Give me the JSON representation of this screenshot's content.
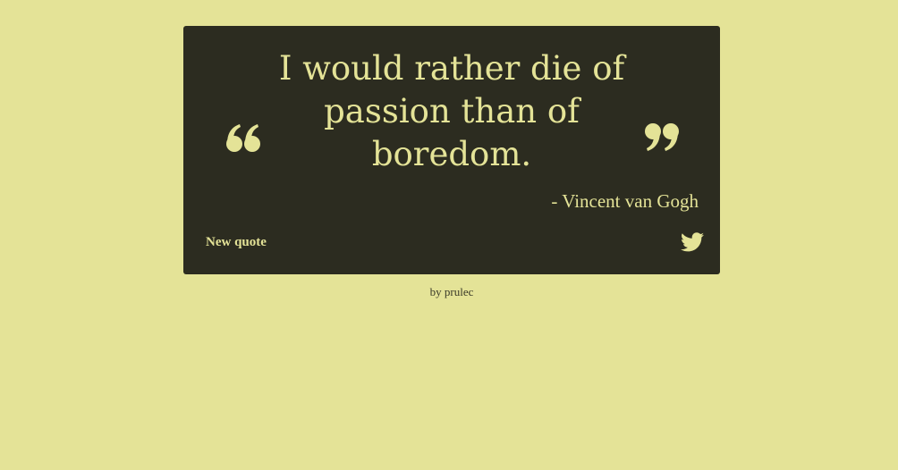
{
  "quote": {
    "text": "I would rather die of passion than of boredom.",
    "author": "- Vincent van Gogh"
  },
  "actions": {
    "new_quote_label": "New quote",
    "tweet_icon": "twitter-icon"
  },
  "footer": {
    "prefix": "by",
    "author_link": "prulec"
  },
  "colors": {
    "background": "#e4e397",
    "card": "#2c2c20",
    "accent": "#e4e397"
  }
}
